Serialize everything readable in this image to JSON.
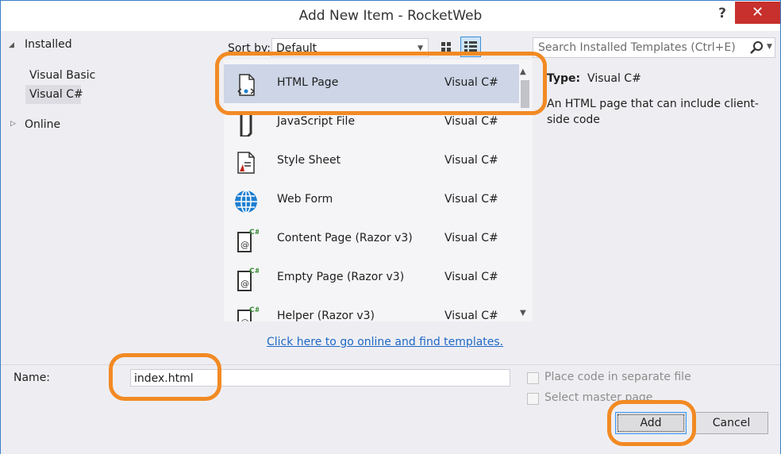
{
  "window": {
    "title": "Add New Item - RocketWeb",
    "help_label": "?",
    "close_label": "✕"
  },
  "tree": {
    "installed": "Installed",
    "visual_basic": "Visual Basic",
    "visual_csharp": "Visual C#",
    "online": "Online"
  },
  "sort": {
    "label": "Sort by:",
    "value": "Default"
  },
  "templates": [
    {
      "name": "HTML Page",
      "language": "Visual C#",
      "icon": "html-page-icon",
      "selected": true
    },
    {
      "name": "JavaScript File",
      "language": "Visual C#",
      "icon": "javascript-file-icon"
    },
    {
      "name": "Style Sheet",
      "language": "Visual C#",
      "icon": "style-sheet-icon"
    },
    {
      "name": "Web Form",
      "language": "Visual C#",
      "icon": "globe-icon"
    },
    {
      "name": "Content Page (Razor v3)",
      "language": "Visual C#",
      "icon": "razor-page-icon"
    },
    {
      "name": "Empty Page (Razor v3)",
      "language": "Visual C#",
      "icon": "razor-page-icon"
    },
    {
      "name": "Helper (Razor v3)",
      "language": "Visual C#",
      "icon": "razor-page-icon"
    }
  ],
  "search": {
    "placeholder": "Search Installed Templates (Ctrl+E)"
  },
  "details": {
    "type_label": "Type:",
    "type_value": "Visual C#",
    "description": "An HTML page that can include client-side code"
  },
  "online_link": "Click here to go online and find templates.",
  "name_field": {
    "label": "Name:",
    "value": "index.html"
  },
  "options": {
    "separate_file": "Place code in separate file",
    "master_page": "Select master page"
  },
  "buttons": {
    "add": "Add",
    "cancel": "Cancel"
  },
  "colors": {
    "highlight": "#f28a23",
    "close_button": "#c7302c",
    "link": "#1e68c7",
    "selection": "#cdd5e6"
  }
}
